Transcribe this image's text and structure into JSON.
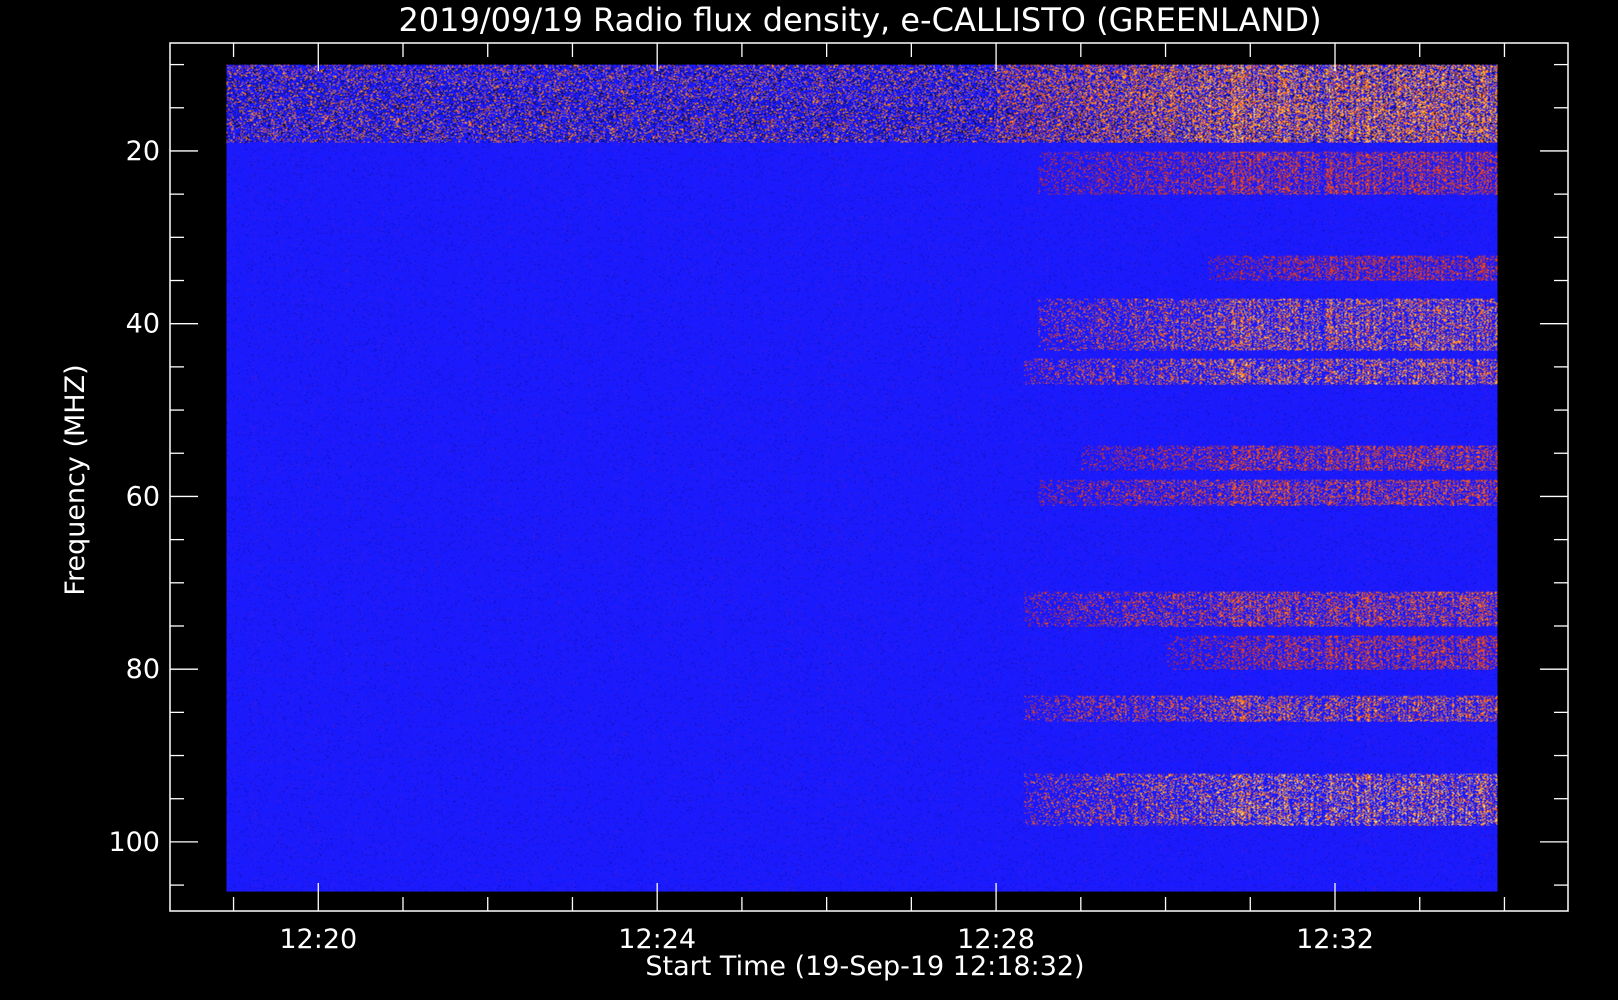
{
  "chart_data": {
    "type": "heatmap",
    "title": "2019/09/19  Radio flux density, e-CALLISTO (GREENLAND)",
    "xlabel": "Start Time (19-Sep-19 12:18:32)",
    "ylabel": "Frequency (MHZ)",
    "x_axis": {
      "unit": "time",
      "range": [
        "12:18:15",
        "12:34:45"
      ],
      "data_range": [
        "12:18:55",
        "12:33:55"
      ],
      "major_ticks": [
        "12:20",
        "12:24",
        "12:28",
        "12:32"
      ],
      "minor_tick_interval_min": 1
    },
    "y_axis": {
      "unit": "MHz",
      "range": [
        7.5,
        108
      ],
      "inverted": true,
      "data_range": [
        10,
        105.8
      ],
      "major_ticks": [
        20,
        40,
        60,
        80,
        100
      ],
      "minor_tick_interval": 5
    },
    "colormap": [
      "#000000",
      "#1a1aff",
      "#c01c1c",
      "#ff5a1a",
      "#ffb030",
      "#ffffc0"
    ],
    "background_level_color": "#1a1aff",
    "quiet_period": [
      "12:18:55",
      "12:28:00"
    ],
    "noise_onset": "12:28",
    "persistent_band_mhz": [
      10,
      19
    ],
    "emission_bands": [
      {
        "freq_mhz": [
          10,
          19
        ],
        "start": "12:28:00",
        "end": "12:33:55",
        "peak_intensity": 0.9
      },
      {
        "freq_mhz": [
          20,
          25
        ],
        "start": "12:28:30",
        "end": "12:33:55",
        "peak_intensity": 0.45
      },
      {
        "freq_mhz": [
          32,
          35
        ],
        "start": "12:30:30",
        "end": "12:33:55",
        "peak_intensity": 0.4
      },
      {
        "freq_mhz": [
          37,
          43
        ],
        "start": "12:28:30",
        "end": "12:33:55",
        "peak_intensity": 0.85
      },
      {
        "freq_mhz": [
          44,
          47
        ],
        "start": "12:28:20",
        "end": "12:33:55",
        "peak_intensity": 0.85
      },
      {
        "freq_mhz": [
          54,
          57
        ],
        "start": "12:29:00",
        "end": "12:33:55",
        "peak_intensity": 0.5
      },
      {
        "freq_mhz": [
          58,
          61
        ],
        "start": "12:28:30",
        "end": "12:33:55",
        "peak_intensity": 0.55
      },
      {
        "freq_mhz": [
          71,
          75
        ],
        "start": "12:28:20",
        "end": "12:33:55",
        "peak_intensity": 0.6
      },
      {
        "freq_mhz": [
          76,
          80
        ],
        "start": "12:30:00",
        "end": "12:33:55",
        "peak_intensity": 0.45
      },
      {
        "freq_mhz": [
          83,
          86
        ],
        "start": "12:28:20",
        "end": "12:33:55",
        "peak_intensity": 0.75
      },
      {
        "freq_mhz": [
          92,
          98
        ],
        "start": "12:28:20",
        "end": "12:33:55",
        "peak_intensity": 0.95
      }
    ]
  }
}
